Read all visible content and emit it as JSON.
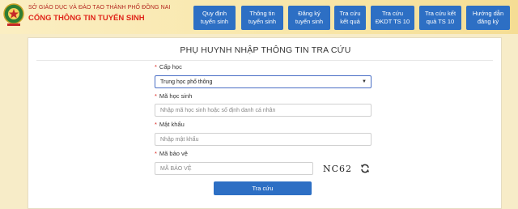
{
  "header": {
    "org_name": "SỞ GIÁO DỤC VÀ ĐÀO TẠO THÀNH PHỐ ĐỒNG NAI",
    "portal_name": "CỔNG THÔNG TIN TUYỂN SINH",
    "logo_icon": "provincial-emblem-icon",
    "nav": [
      {
        "label": "Quy định tuyển sinh"
      },
      {
        "label": "Thông tin tuyển sinh"
      },
      {
        "label": "Đăng ký tuyển sinh"
      },
      {
        "label": "Tra cứu kết quả"
      },
      {
        "label": "Tra cứu ĐKDT TS 10"
      },
      {
        "label": "Tra cứu kết quả TS 10"
      },
      {
        "label": "Hướng dẫn đăng ký"
      }
    ]
  },
  "form": {
    "title": "PHỤ HUYNH NHẬP THÔNG TIN TRA CỨU",
    "required_mark": "*",
    "level_label": "Cấp học",
    "level_value": "Trung học phổ thông",
    "student_id_label": "Mã học sinh",
    "student_id_placeholder": "Nhập mã học sinh hoặc số định danh cá nhân",
    "password_label": "Mật khẩu",
    "password_placeholder": "Nhập mật khẩu",
    "captcha_label": "Mã bảo vệ",
    "captcha_placeholder": "MÃ BẢO VỆ",
    "captcha_text": "NC62",
    "submit_label": "Tra cứu"
  },
  "colors": {
    "accent": "#2d6fc4",
    "header_bg": "#f8e6a8",
    "required": "#d9231b"
  }
}
